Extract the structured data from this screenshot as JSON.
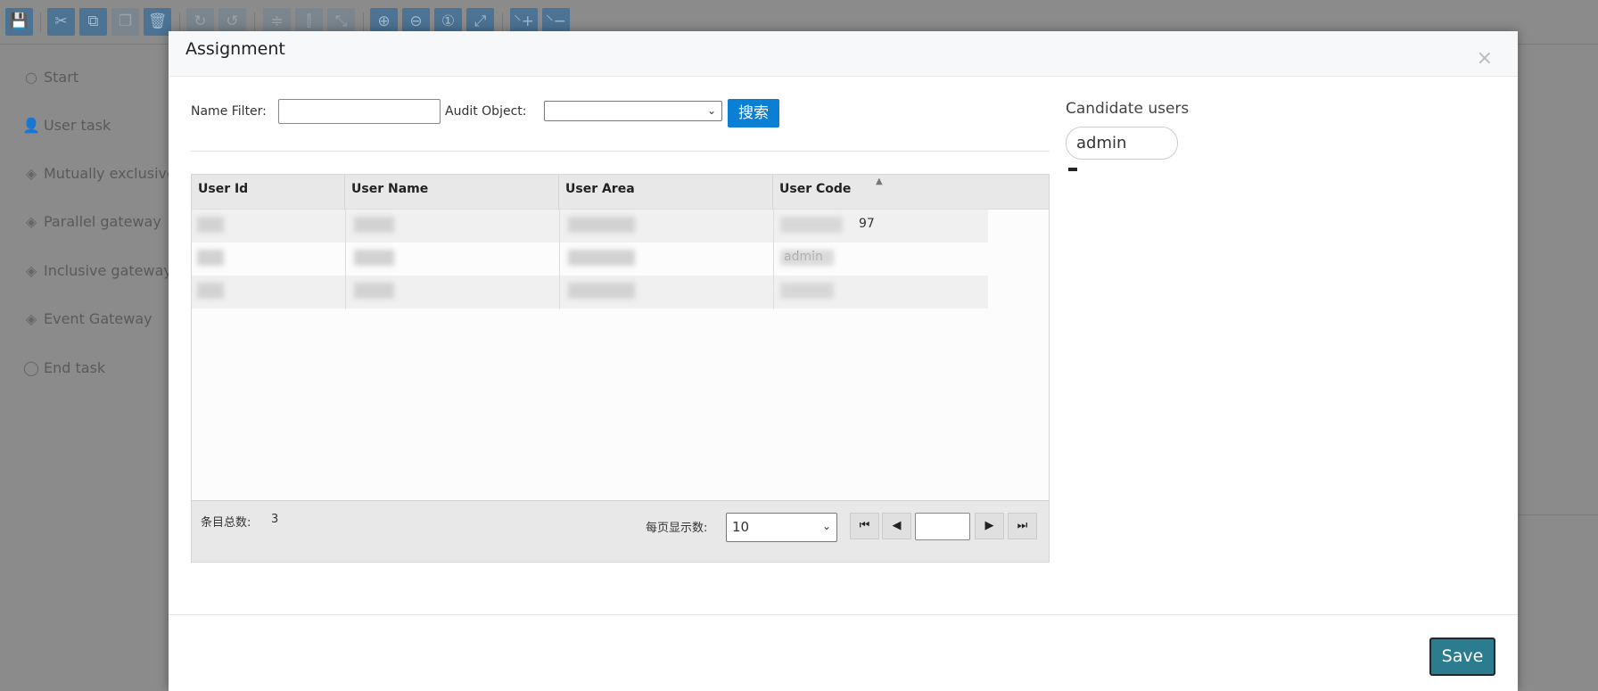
{
  "toolbar": {
    "buttons": [
      {
        "icon": "save-icon",
        "glyph": "💾",
        "enabled": true
      },
      {
        "icon": "cut-icon",
        "glyph": "✂",
        "enabled": true
      },
      {
        "icon": "copy-icon",
        "glyph": "⧉",
        "enabled": true
      },
      {
        "icon": "paste-icon",
        "glyph": "❐",
        "enabled": false
      },
      {
        "icon": "delete-icon",
        "glyph": "🗑",
        "enabled": true
      },
      {
        "icon": "redo-icon",
        "glyph": "↻",
        "enabled": false
      },
      {
        "icon": "undo-icon",
        "glyph": "↺",
        "enabled": false
      },
      {
        "icon": "align-horizontal-icon",
        "glyph": "≑",
        "enabled": false
      },
      {
        "icon": "align-vertical-icon",
        "glyph": "⫿",
        "enabled": false
      },
      {
        "icon": "resize-icon",
        "glyph": "⤡",
        "enabled": false
      },
      {
        "icon": "zoom-in-icon",
        "glyph": "⊕",
        "enabled": true
      },
      {
        "icon": "zoom-out-icon",
        "glyph": "⊖",
        "enabled": true
      },
      {
        "icon": "zoom-actual-icon",
        "glyph": "①",
        "enabled": true
      },
      {
        "icon": "fit-icon",
        "glyph": "⤢",
        "enabled": true
      },
      {
        "icon": "add-bendpoint-icon",
        "glyph": "⸌+",
        "enabled": true
      },
      {
        "icon": "remove-bendpoint-icon",
        "glyph": "⸌−",
        "enabled": true
      }
    ]
  },
  "palette": [
    {
      "label": "Start",
      "icon": "circle-icon",
      "glyph": "○"
    },
    {
      "label": "User task",
      "icon": "user-icon",
      "glyph": "👤"
    },
    {
      "label": "Mutually exclusive g",
      "icon": "exclusive-gateway-icon",
      "glyph": "◈"
    },
    {
      "label": "Parallel gateway",
      "icon": "parallel-gateway-icon",
      "glyph": "◈"
    },
    {
      "label": "Inclusive gateway",
      "icon": "inclusive-gateway-icon",
      "glyph": "◈"
    },
    {
      "label": "Event Gateway",
      "icon": "event-gateway-icon",
      "glyph": "◈"
    },
    {
      "label": "End task",
      "icon": "end-circle-icon",
      "glyph": "◯"
    }
  ],
  "modal": {
    "title": "Assignment",
    "close": "×",
    "filter": {
      "name_label": "Name Filter:",
      "name_value": "",
      "audit_label": "Audit Object:",
      "audit_value": "",
      "search_label": "搜索"
    },
    "grid": {
      "columns": [
        "User Id",
        "User Name",
        "User Area",
        "User Code"
      ],
      "sort_column": "User Code",
      "rows": [
        {
          "code_visible": "97"
        },
        {
          "code_visible": "admin"
        },
        {
          "code_visible": ""
        }
      ],
      "footer": {
        "total_label": "条目总数:",
        "total": "3",
        "page_size_label": "每页显示数:",
        "page_size": "10",
        "page_input": ""
      }
    },
    "candidate": {
      "title": "Candidate users",
      "users": [
        "admin"
      ]
    },
    "save_label": "Save"
  }
}
